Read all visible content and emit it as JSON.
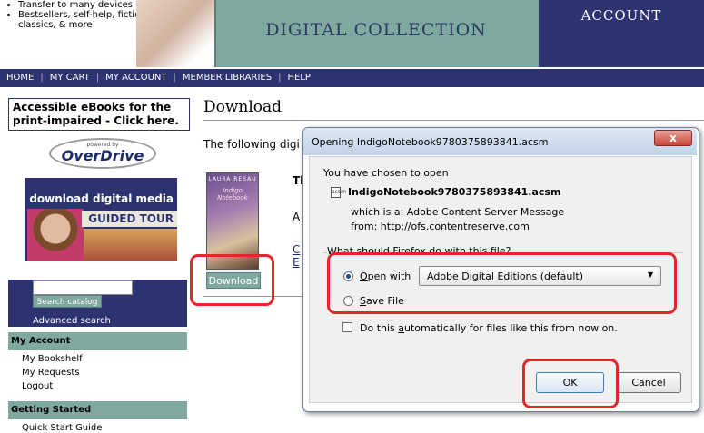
{
  "banner": {
    "promo": [
      "Transfer to many devices",
      "Bestsellers, self-help, fiction, classics, & more!"
    ],
    "title": "DIGITAL COLLECTION",
    "account": "ACCOUNT"
  },
  "nav": {
    "items": [
      "HOME",
      "MY CART",
      "MY ACCOUNT",
      "MEMBER LIBRARIES",
      "HELP"
    ]
  },
  "sidebar": {
    "accessible": "Accessible eBooks for the print-impaired - Click here.",
    "overdrive": {
      "powered": "powered by",
      "name": "OverDrive"
    },
    "tour": {
      "line1": "download digital media",
      "line2": "GUIDED TOUR"
    },
    "search_button": "Search catalog",
    "advanced_search": "Advanced search",
    "my_account": {
      "heading": "My Account",
      "links": [
        "My Bookshelf",
        "My Requests",
        "Logout"
      ]
    },
    "getting_started": {
      "heading": "Getting Started",
      "links": [
        "Quick Start Guide"
      ]
    }
  },
  "main": {
    "heading": "Download",
    "intro": "The following digi",
    "book": {
      "author": "LAURA RESAU",
      "title": "Indigo Notebook"
    },
    "frag_title": "Th",
    "frag_a": "A",
    "frag_link1": "C",
    "frag_link2": "E",
    "download_button": "Download"
  },
  "dialog": {
    "title": "Opening IndigoNotebook9780375893841.acsm",
    "close": "x",
    "chosen": "You have chosen to open",
    "file_icon": "acsm",
    "filename": "IndigoNotebook9780375893841.acsm",
    "which_is": "which is a:  Adobe Content Server Message",
    "from": "from:  http://ofs.contentreserve.com",
    "question": "What should Firefox do with this file?",
    "open_with": {
      "pre": "",
      "underline": "O",
      "rest": "pen with"
    },
    "open_with_app": "Adobe Digital Editions (default)",
    "save_file": {
      "underline": "S",
      "rest": "ave File"
    },
    "auto": {
      "pre": "Do this ",
      "underline": "a",
      "rest": "utomatically for files like this from now on."
    },
    "ok": "OK",
    "cancel": "Cancel",
    "selected_option": "open_with",
    "auto_checked": false
  },
  "colors": {
    "navy": "#2d3370",
    "teal": "#7ea8a0",
    "highlight": "#e4262b"
  }
}
